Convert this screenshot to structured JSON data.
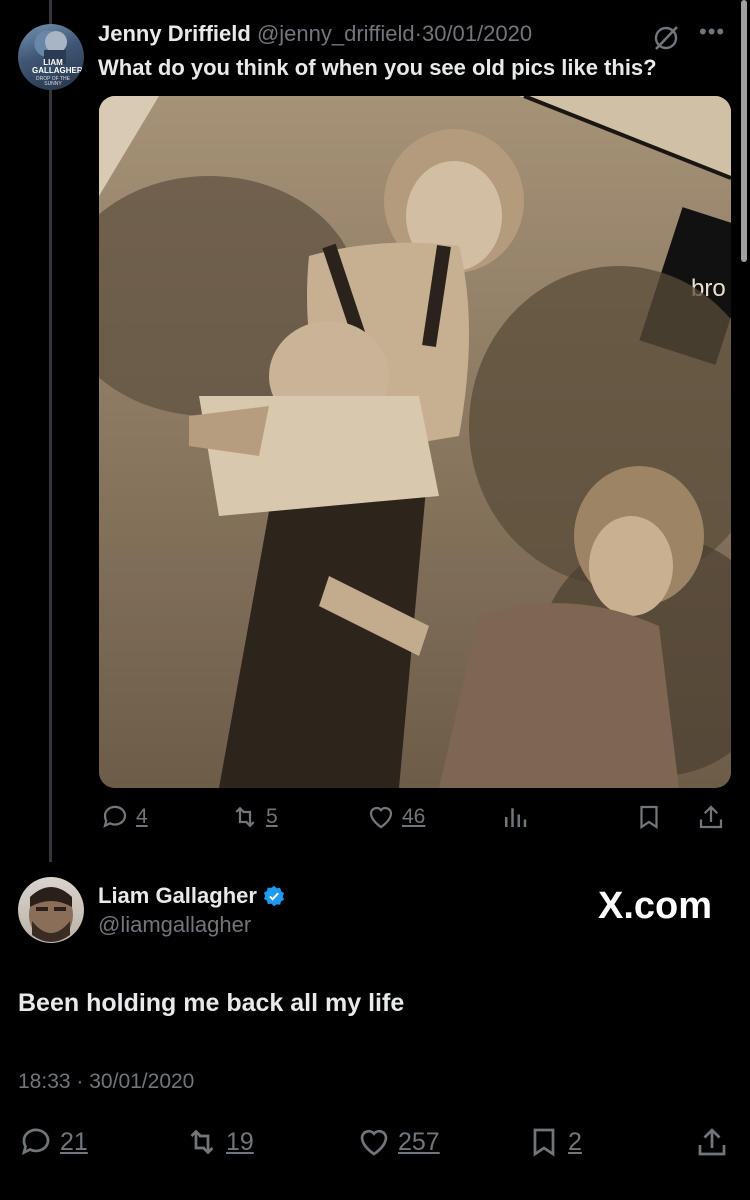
{
  "quoted_tweet": {
    "author_name": "Jenny Driffield",
    "author_handle": "@jenny_driffield",
    "separator": "·",
    "date": "30/01/2020",
    "text": "What do you think of when you see old pics like this?",
    "avatar_text": "LIAM GALLAGHER",
    "avatar_subtext": "DROP OF THE SUNNY",
    "photo_overlay_text": "bro",
    "stats": {
      "replies": "4",
      "reposts": "5",
      "likes": "46"
    },
    "icons": [
      "grok-icon",
      "more-icon",
      "reply-icon",
      "repost-icon",
      "like-icon",
      "views-icon",
      "bookmark-icon",
      "share-icon"
    ]
  },
  "main_tweet": {
    "author_name": "Liam Gallagher",
    "author_handle": "@liamgallagher",
    "verified": true,
    "watermark": "X.com",
    "text": "Been holding me back all my life",
    "time": "18:33",
    "separator": "·",
    "date": "30/01/2020",
    "stats": {
      "replies": "21",
      "reposts": "19",
      "likes": "257",
      "bookmarks": "2"
    }
  },
  "colors": {
    "background": "#000000",
    "text": "#e7e9ea",
    "muted": "#71767b",
    "verified": "#1d9bf0"
  }
}
